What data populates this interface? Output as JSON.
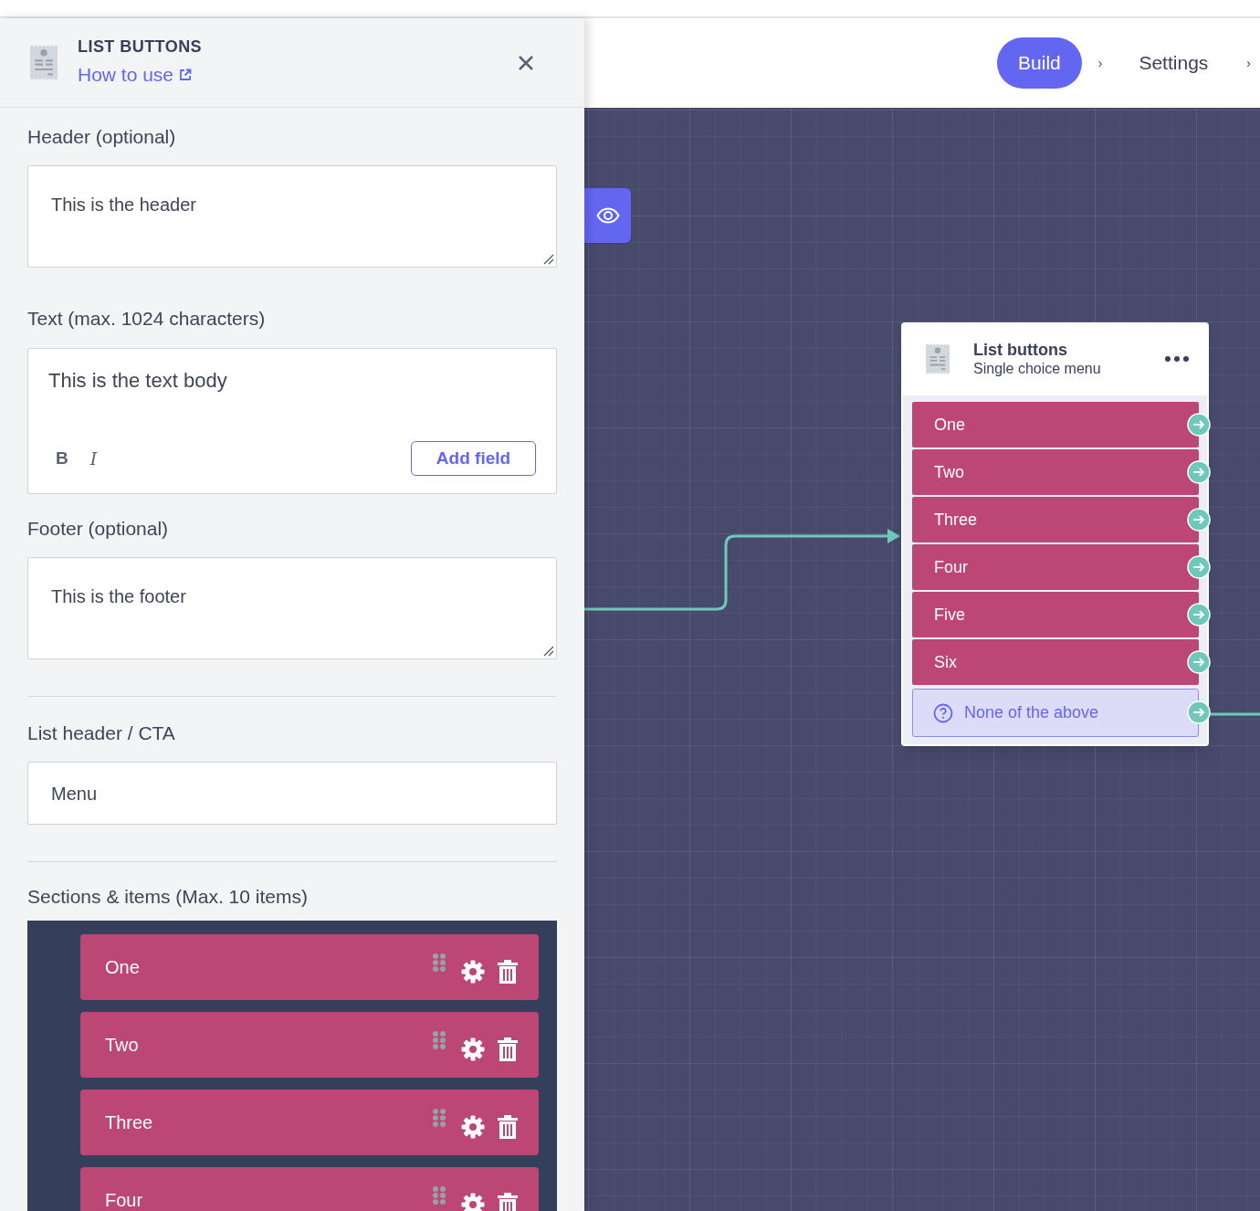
{
  "panel": {
    "title": "LIST BUTTONS",
    "help_link": "How to use",
    "header_field": {
      "label": "Header (optional)",
      "value": "This is the header"
    },
    "text_field": {
      "label": "Text (max. 1024 characters)",
      "value": "This is the text body",
      "format_buttons": [
        "B",
        "I"
      ],
      "add_button": "Add field"
    },
    "footer_field": {
      "label": "Footer (optional)",
      "value": "This is the footer"
    },
    "cta_field": {
      "label": "List header / CTA",
      "value": "Menu"
    },
    "sections": {
      "label": "Sections & items (Max. 10 items)",
      "items": [
        "One",
        "Two",
        "Three",
        "Four"
      ]
    }
  },
  "nav": {
    "steps": [
      {
        "label": "Build",
        "selected": true,
        "chevron": "›"
      },
      {
        "label": "Settings",
        "selected": false,
        "chevron": "›"
      }
    ]
  },
  "node": {
    "title": "List buttons",
    "subtitle": "Single choice menu",
    "options": [
      {
        "kind": "option",
        "label": "One"
      },
      {
        "kind": "option",
        "label": "Two"
      },
      {
        "kind": "option",
        "label": "Three"
      },
      {
        "kind": "option",
        "label": "Four"
      },
      {
        "kind": "option",
        "label": "Five"
      },
      {
        "kind": "option",
        "label": "Six"
      },
      {
        "kind": "fallback",
        "label": "None of the above"
      }
    ]
  }
}
